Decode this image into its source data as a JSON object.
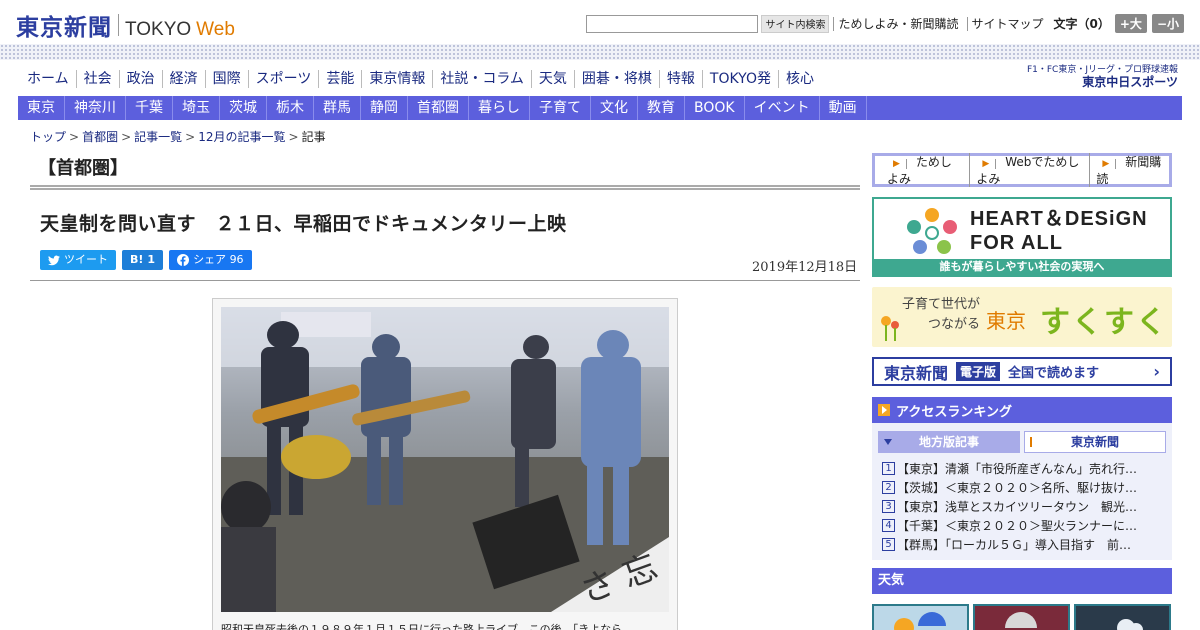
{
  "header": {
    "logo_jp": "東京新聞",
    "logo_en": "TOKYO",
    "logo_web": "Web",
    "search_placeholder": "",
    "search_button": "サイト内検索",
    "links": [
      "ためしよみ・新聞購読",
      "サイトマップ"
    ],
    "font_size_label": "文字（0）",
    "font_bigger": "+大",
    "font_smaller": "−小"
  },
  "main_nav": [
    "ホーム",
    "社会",
    "政治",
    "経済",
    "国際",
    "スポーツ",
    "芸能",
    "東京情報",
    "社説・コラム",
    "天気",
    "囲碁・将棋",
    "特報",
    "TOKYO発",
    "核心"
  ],
  "chunichi": {
    "line1": "F1・FC東京・Jリーグ・プロ野球速報",
    "line2": "東京中日スポーツ"
  },
  "sub_nav": [
    "東京",
    "神奈川",
    "千葉",
    "埼玉",
    "茨城",
    "栃木",
    "群馬",
    "静岡",
    "首都圏",
    "暮らし",
    "子育て",
    "文化",
    "教育",
    "BOOK",
    "イベント",
    "動画"
  ],
  "breadcrumb": [
    "トップ",
    "首都圏",
    "記事一覧",
    "12月の記事一覧",
    "記事"
  ],
  "section_title": "【首都圏】",
  "article": {
    "headline": "天皇制を問い直す　２１日、早稲田でドキュメンタリー上映",
    "date": "2019年12月18日",
    "caption": "昭和天皇死去後の１９８９年１月１５日に行った路上ライブ。この後、「きよなら"
  },
  "share": {
    "tweet": "ツイート",
    "hatena": "B!",
    "hatena_count": "1",
    "share": "シェア",
    "share_count": "96"
  },
  "sidebar": {
    "tameshi": [
      "ためしよみ",
      "Webでためしよみ",
      "新聞購読"
    ],
    "heart_title_1": "HEART＆DESiGN",
    "heart_title_2": "FOR ALL",
    "heart_footer": "誰もが暮らしやすい社会の実現へ",
    "suku_small_1": "子育て世代が",
    "suku_small_2": "つながる",
    "suku_tokyo": "東京",
    "suku_big": "すくすく",
    "denshi_logo": "東京新聞",
    "denshi_tag": "電子版",
    "denshi_text": "全国で読めます",
    "ranking_title": "アクセスランキング",
    "ranking_tabs": [
      "地方版記事",
      "東京新聞"
    ],
    "ranking": [
      {
        "num": "1",
        "text": "【東京】清瀬「市役所産ぎんなん」売れ行…"
      },
      {
        "num": "2",
        "text": "【茨城】＜東京２０２０＞名所、駆け抜け…"
      },
      {
        "num": "3",
        "text": "【東京】浅草とスカイツリータウン　観光…"
      },
      {
        "num": "4",
        "text": "【千葉】＜東京２０２０＞聖火ランナーに…"
      },
      {
        "num": "5",
        "text": "【群馬】「ローカル５Ｇ」導入目指す　前…"
      }
    ],
    "weather_title": "天気"
  },
  "colors": {
    "brand_blue": "#2c3ea0",
    "nav_purple": "#5c5fdd",
    "accent_orange": "#e07b00",
    "heart_green": "#3ea890"
  }
}
